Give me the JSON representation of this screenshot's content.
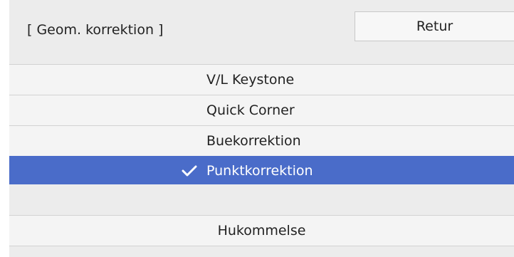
{
  "header": {
    "title": "[ Geom. korrektion ]",
    "return_label": "Retur"
  },
  "menu": {
    "items": [
      {
        "label": "V/L Keystone",
        "selected": false
      },
      {
        "label": "Quick Corner",
        "selected": false
      },
      {
        "label": "Buekorrektion",
        "selected": false
      },
      {
        "label": "Punktkorrektion",
        "selected": true
      }
    ],
    "memory_label": "Hukommelse"
  },
  "colors": {
    "selected_bg": "#4a6cc9",
    "row_bg": "#f4f4f4",
    "panel_bg": "#ececec"
  },
  "icons": {
    "selected_marker": "checkmark-icon"
  }
}
